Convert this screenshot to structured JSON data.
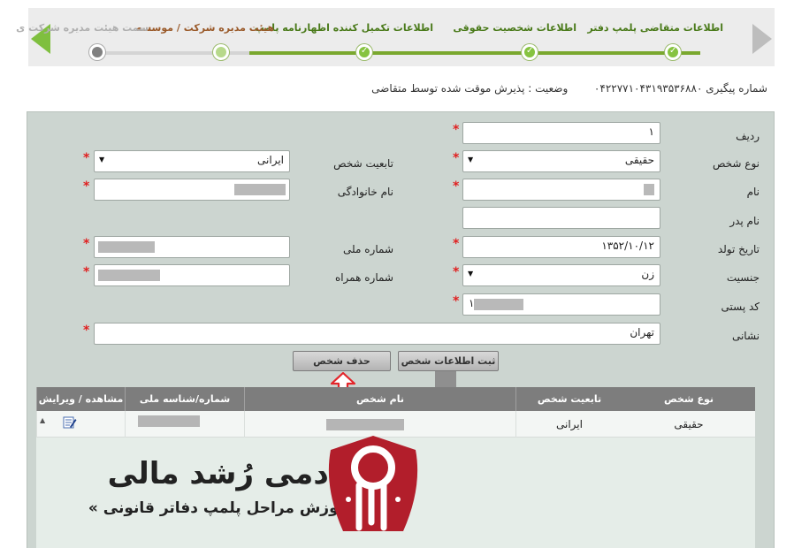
{
  "wizard": {
    "steps": [
      {
        "label": "اطلاعات متقاضی پلمپ دفتر",
        "state": "done"
      },
      {
        "label": "اطلاعات شخصیت حقوقی",
        "state": "done"
      },
      {
        "label": "اطلاعات تکمیل کننده اظهارنامه پلمپ",
        "state": "done"
      },
      {
        "label": "هیئت مدیره شرکت / موسسه",
        "state": "current"
      },
      {
        "label": "سمت هیئت مدیره شرکت ی",
        "state": "todo"
      }
    ]
  },
  "status": {
    "tracking_label": "شماره پیگیری",
    "tracking_number": "۰۴۲۲۷۷۱۰۴۳۱۹۳۵۳۶۸۸۰",
    "state_text": "وضعیت : پذیرش موقت شده توسط متقاضی"
  },
  "form": {
    "row_label": "ردیف",
    "row_value": "۱",
    "person_type_label": "نوع شخص",
    "person_type_value": "حقیقی",
    "nationality_label": "تابعیت شخص",
    "nationality_value": "ایرانی",
    "first_name_label": "نام",
    "last_name_label": "نام خانوادگی",
    "father_name_label": "نام پدر",
    "birth_date_label": "تاریخ تولد",
    "birth_date_value": "۱۳۵۲/۱۰/۱۲",
    "national_code_label": "شماره ملی",
    "gender_label": "جنسیت",
    "gender_value": "زن",
    "mobile_label": "شماره همراه",
    "postal_code_label": "کد پستی",
    "postal_code_value": "۱",
    "address_label": "نشانی",
    "address_value": "تهران",
    "required_mark": "*",
    "save_button": "ثبت اطلاعات شخص",
    "delete_button": "حذف شخص"
  },
  "grid": {
    "columns": [
      "نوع شخص",
      "تابعیت شخص",
      "نام شخص",
      "شماره/شناسه ملی",
      "مشاهده / ویرایش"
    ],
    "rows": [
      {
        "person_type": "حقیقی",
        "nationality": "ایرانی"
      }
    ]
  },
  "watermark": {
    "title": "آکادمی رُشد مالی",
    "subtitle": "« آموزش مراحل پلمپ دفاتر قانونی »"
  },
  "colors": {
    "accent_green": "#7aa82e",
    "panel_bg": "#ccd5d0",
    "grid_header": "#7d7d7d",
    "logo_red": "#b21e2b",
    "required_red": "#e02020"
  }
}
